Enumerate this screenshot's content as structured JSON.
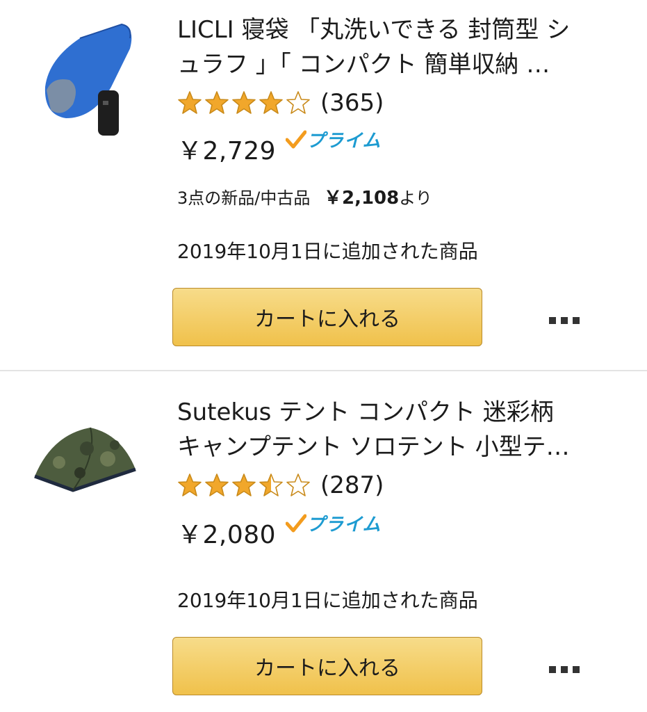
{
  "items": [
    {
      "title_line1": "LICLI 寝袋 「丸洗いできる 封筒型 シ",
      "title_line2": "ュラフ 」「 コンパクト 簡単収納 …",
      "rating": 4.0,
      "review_count": "(365)",
      "price": "￥2,729",
      "prime_label": "プライム",
      "offers_prefix": "3点の新品/中古品",
      "offers_price": "￥2,108",
      "offers_suffix": "より",
      "added_text": "2019年10月1日に追加された商品",
      "cart_label": "カートに入れる",
      "image_icon": "sleeping-bag-image"
    },
    {
      "title_line1": "Sutekus テント コンパクト 迷彩柄",
      "title_line2": "キャンプテント ソロテント 小型テ…",
      "rating": 3.5,
      "review_count": "(287)",
      "price": "￥2,080",
      "prime_label": "プライム",
      "added_text": "2019年10月1日に追加された商品",
      "cart_label": "カートに入れる",
      "image_icon": "tent-image"
    }
  ],
  "colors": {
    "star": "#f1a72b",
    "prime_check": "#f39c1e",
    "prime_text": "#1d9bd1",
    "button": "#f0c14b"
  }
}
